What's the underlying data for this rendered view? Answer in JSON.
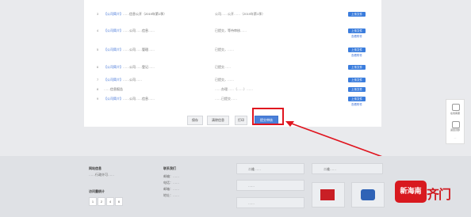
{
  "rows": [
    {
      "idx": "3",
      "tag": "【公司简介】",
      "title": "……信息公开（2019年第1季）",
      "desc": "公司……公开……（2019年第1季）",
      "op": "上传文件",
      "link": ""
    },
    {
      "idx": "4",
      "tag": "【公司简介】",
      "title": "……公司……信息……",
      "desc": "已提交，等待审核……",
      "op": "上传文件",
      "link": "查看附件"
    },
    {
      "idx": "5",
      "tag": "【公司简介】",
      "title": "……公司……管理……",
      "desc": "已提交，……",
      "op": "上传文件",
      "link": "查看附件"
    },
    {
      "idx": "6",
      "tag": "【公司简介】",
      "title": "……公司……登记……",
      "desc": "已提交……",
      "op": "上传文件",
      "link": ""
    },
    {
      "idx": "7",
      "tag": "【公司简介】",
      "title": "……公司……",
      "desc": "已提交，……",
      "op": "上传文件",
      "link": ""
    },
    {
      "idx": "8",
      "tag": "",
      "title": "……信息报告",
      "desc": "……办理……（……）……",
      "op": "上传文件",
      "link": ""
    },
    {
      "idx": "9",
      "tag": "【公司简介】",
      "title": "……公司……信息……",
      "desc": "……已提交……",
      "op": "上传文件",
      "link": "查看附件"
    }
  ],
  "buttons": {
    "save": "保存",
    "back": "清除信息",
    "print": "打印",
    "submit": "提交审核"
  },
  "side": {
    "service": "在线客服",
    "top": "返回顶部",
    "more": "…"
  },
  "footer": {
    "org_title": "网站信息",
    "org_line": "……行政许可……",
    "count_title": "访问量统计",
    "count_digits": [
      "1",
      "2",
      "4",
      "6"
    ],
    "contact_title": "联系我们",
    "contact_lines": [
      "邮编：……",
      "电话：……",
      "邮箱：……",
      "地址：……"
    ],
    "box1": "二维……",
    "box2": "……",
    "box3": "……",
    "box4": "二维……"
  },
  "watermark": {
    "badge": "新海南",
    "text": "齐门"
  }
}
